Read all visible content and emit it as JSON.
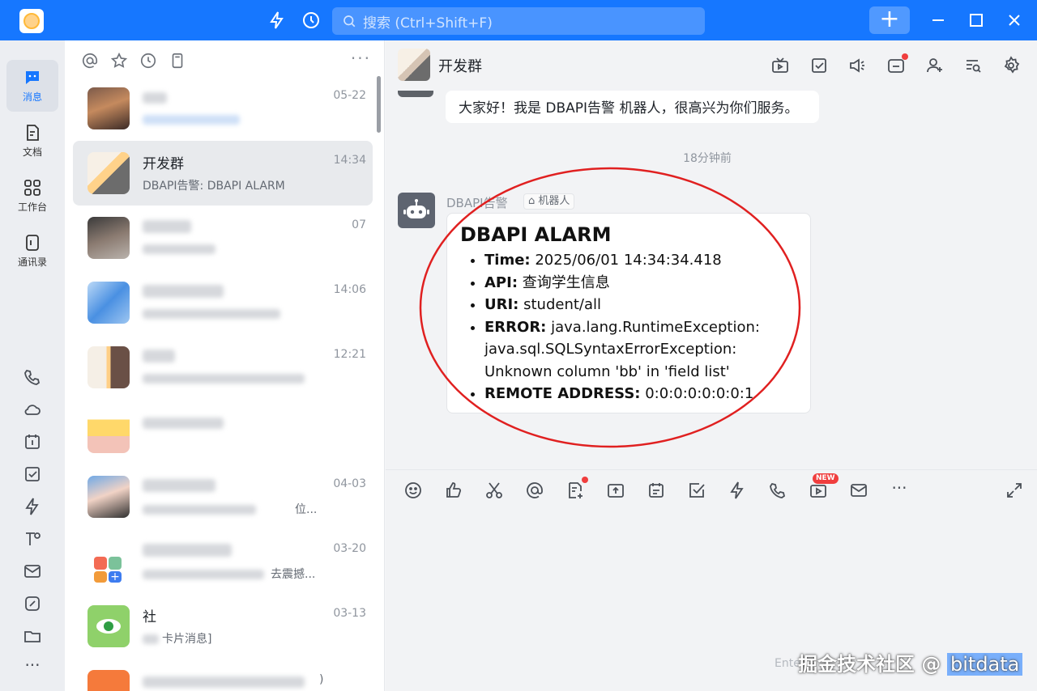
{
  "titlebar": {
    "search_placeholder": "搜索 (Ctrl+Shift+F)",
    "plus_label": "+",
    "accent_color": "#1677ff"
  },
  "rail": {
    "items": [
      {
        "label": "消息",
        "icon": "message-icon"
      },
      {
        "label": "文档",
        "icon": "document-icon"
      },
      {
        "label": "工作台",
        "icon": "workspace-icon"
      },
      {
        "label": "通讯录",
        "icon": "contacts-icon"
      }
    ],
    "more_label": "···"
  },
  "conversations": [
    {
      "name": "",
      "time": "05-22",
      "preview": ""
    },
    {
      "name": "开发群",
      "time": "14:34",
      "preview": "DBAPI告警: DBAPI ALARM"
    },
    {
      "name": "",
      "time": "07",
      "preview": ""
    },
    {
      "name": "",
      "time": "14:06",
      "preview": ""
    },
    {
      "name": "",
      "time": "12:21",
      "preview": ""
    },
    {
      "name": "",
      "time": "",
      "preview": ""
    },
    {
      "name": "",
      "time": "04-03",
      "preview": "位..."
    },
    {
      "name": "",
      "time": "03-20",
      "preview": "去震撼..."
    },
    {
      "name": "社",
      "time": "03-13",
      "preview": "卡片消息]"
    },
    {
      "name": "",
      "time": "",
      "preview": ")"
    }
  ],
  "chat": {
    "title": "开发群",
    "greeting": "大家好！我是 DBAPI告警 机器人，很高兴为你们服务。",
    "timestamp": "18分钟前",
    "sender": "DBAPI告警",
    "bot_badge": "机器人",
    "alarm": {
      "title": "DBAPI ALARM",
      "fields": [
        {
          "key": "Time:",
          "value": "2025/06/01 14:34:34.418"
        },
        {
          "key": "API:",
          "value": "查询学生信息"
        },
        {
          "key": "URI:",
          "value": "student/all"
        },
        {
          "key": "ERROR:",
          "value": "java.lang.RuntimeException: java.sql.SQLSyntaxErrorException: Unknown column 'bb' in 'field list'"
        },
        {
          "key": "REMOTE ADDRESS:",
          "value": "0:0:0:0:0:0:0:1"
        }
      ]
    },
    "new_badge": "NEW",
    "input_placeholder": "Enter",
    "watermark_text": "掘金技术社区 @",
    "watermark_user": "bitdata",
    "highlight_color": "#e02020"
  }
}
